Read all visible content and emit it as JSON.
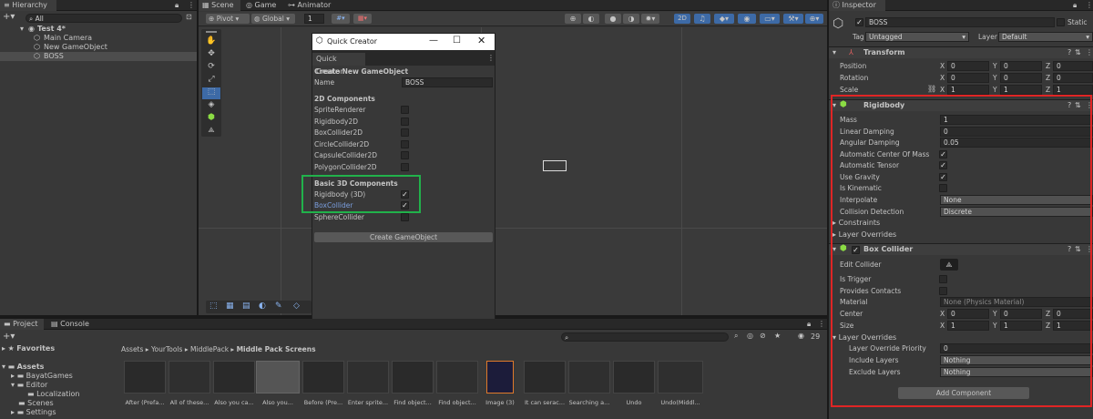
{
  "hierarchy": {
    "tab": "Hierarchy",
    "search_placeholder": "All",
    "scene": "Test 4*",
    "items": [
      "Main Camera",
      "New GameObject",
      "BOSS"
    ]
  },
  "scene_tabs": [
    "Scene",
    "Game",
    "Animator"
  ],
  "scene_toolbar": {
    "pivot": "Pivot",
    "global": "Global",
    "snap_value": "1",
    "mode_2d": "2D"
  },
  "quick_creator": {
    "window_title": "Quick Creator",
    "tab": "Quick Creator",
    "heading": "Create New GameObject",
    "name_label": "Name",
    "name_value": "BOSS",
    "section_2d": "2D Components",
    "comps_2d": [
      "SpriteRenderer",
      "Rigidbody2D",
      "BoxCollider2D",
      "CircleCollider2D",
      "CapsuleCollider2D",
      "PolygonCollider2D"
    ],
    "section_3d": "Basic 3D Components",
    "comps_3d": [
      {
        "label": "Rigidbody (3D)",
        "checked": true
      },
      {
        "label": "BoxCollider",
        "checked": true
      },
      {
        "label": "SphereCollider",
        "checked": false
      }
    ],
    "create_button": "Create GameObject"
  },
  "inspector": {
    "tab": "Inspector",
    "object_name": "BOSS",
    "static_label": "Static",
    "tag_label": "Tag",
    "tag_value": "Untagged",
    "layer_label": "Layer",
    "layer_value": "Default",
    "transform": {
      "title": "Transform",
      "rows": [
        {
          "label": "Position",
          "x": "0",
          "y": "0",
          "z": "0"
        },
        {
          "label": "Rotation",
          "x": "0",
          "y": "0",
          "z": "0"
        },
        {
          "label": "Scale",
          "x": "1",
          "y": "1",
          "z": "1"
        }
      ]
    },
    "rigidbody": {
      "title": "Rigidbody",
      "mass_label": "Mass",
      "mass": "1",
      "linear_label": "Linear Damping",
      "linear": "0",
      "angular_label": "Angular Damping",
      "angular": "0.05",
      "auto_com": "Automatic Center Of Mass",
      "auto_tensor": "Automatic Tensor",
      "use_gravity": "Use Gravity",
      "kinematic": "Is Kinematic",
      "interpolate_label": "Interpolate",
      "interpolate": "None",
      "collision_label": "Collision Detection",
      "collision": "Discrete",
      "constraints": "Constraints",
      "layer_overrides": "Layer Overrides"
    },
    "box_collider": {
      "title": "Box Collider",
      "edit_label": "Edit Collider",
      "trigger": "Is Trigger",
      "contacts": "Provides Contacts",
      "material_label": "Material",
      "material": "None (Physics Material)",
      "center_label": "Center",
      "cx": "0",
      "cy": "0",
      "cz": "0",
      "size_label": "Size",
      "sx": "1",
      "sy": "1",
      "sz": "1",
      "overrides": "Layer Overrides",
      "priority_label": "Layer Override Priority",
      "priority": "0",
      "include_label": "Include Layers",
      "include": "Nothing",
      "exclude_label": "Exclude Layers",
      "exclude": "Nothing"
    },
    "add_component": "Add Component"
  },
  "project": {
    "tabs": [
      "Project",
      "Console"
    ],
    "favorites": "Favorites",
    "assets": "Assets",
    "folders": [
      "BayatGames",
      "Editor",
      "Localization",
      "Scenes",
      "Settings"
    ],
    "breadcrumb": [
      "Assets",
      "YourTools",
      "MiddlePack",
      "Middle Pack Screens"
    ],
    "count": "29",
    "thumbs": [
      "After (Prefa...",
      "All of these...",
      "Also you ca...",
      "Also you...",
      "Before (Pre...",
      "Enter sprite...",
      "Find object...",
      "Find object...",
      "Image (3)",
      "It can serac...",
      "Searching a...",
      "Undo",
      "Undo(Middl..."
    ]
  },
  "colors": {
    "highlight_red": "#e02525",
    "highlight_green": "#21b24b",
    "accent_blue": "#3d6aa6"
  }
}
